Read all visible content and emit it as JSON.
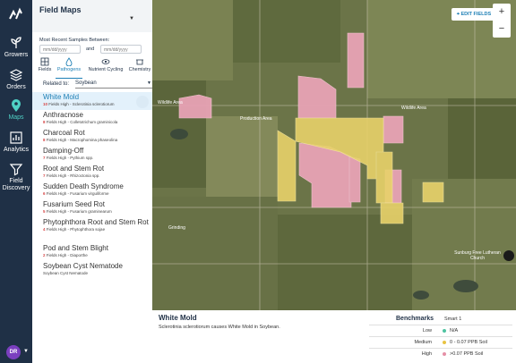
{
  "nav": {
    "items": [
      {
        "label": "Growers",
        "icon": "growers-icon"
      },
      {
        "label": "Orders",
        "icon": "orders-icon"
      },
      {
        "label": "Maps",
        "icon": "map-pin-icon"
      },
      {
        "label": "Analytics",
        "icon": "analytics-icon"
      },
      {
        "label": "Field Discovery",
        "icon": "filter-icon"
      }
    ],
    "avatar": "DR"
  },
  "panel": {
    "title": "Field Maps",
    "samples_label": "Most Recent Samples Between:",
    "date_from_placeholder": "mm/dd/yyyy",
    "date_and": "and",
    "date_to_placeholder": "mm/dd/yyyy",
    "tabs": [
      "Fields",
      "Pathogens",
      "Nutrient Cycling",
      "Chemistry"
    ],
    "related_label": "Related to:",
    "related_value": "Soybean",
    "pathogens": [
      {
        "name": "White Mold",
        "count": "10",
        "sub": "Fields High - Sclerotinia sclerotiorum"
      },
      {
        "name": "Anthracnose",
        "count": "8",
        "sub": "Fields High - Colletotrichum graminicola"
      },
      {
        "name": "Charcoal Rot",
        "count": "8",
        "sub": "Fields High - Macrophomina phaseolina"
      },
      {
        "name": "Damping-Off",
        "count": "7",
        "sub": "Fields High - Pythium spp."
      },
      {
        "name": "Root and Stem Rot",
        "count": "7",
        "sub": "Fields High - Rhizoctonia spp."
      },
      {
        "name": "Sudden Death Syndrome",
        "count": "6",
        "sub": "Fields High - Fusarium virguliforme"
      },
      {
        "name": "Fusarium Seed Rot",
        "count": "5",
        "sub": "Fields High - Fusarium graminearum"
      },
      {
        "name": "Phytophthora Root and Stem Rot",
        "count": "4",
        "sub": "Fields High - Phytophthora sojae"
      },
      {
        "name": "Pod and Stem Blight",
        "count": "2",
        "sub": "Fields High - Diaporthe"
      },
      {
        "name": "Soybean Cyst Nematode",
        "count": "",
        "sub": "Soybean Cyst Nematode"
      }
    ]
  },
  "map": {
    "edit_button": "EDIT FIELDS",
    "zoom_in": "+",
    "zoom_out": "−",
    "labels": {
      "wildlife1": "Wildlife Area",
      "wildlife2": "Wildlife Area",
      "production": "Production Area",
      "church": "Sunburg Free Lutheran Church",
      "grinding": "Grinding"
    }
  },
  "info": {
    "title": "White Mold",
    "description": "Sclerotinia sclerotiorum causes White Mold in Soybean.",
    "benchmarks_label": "Benchmarks",
    "benchmark_source": "Smart 1",
    "rows": [
      {
        "level": "Low",
        "value": "N/A",
        "color": "#4fc3a1"
      },
      {
        "level": "Medium",
        "value": "0 - 0.07 PPB Soil",
        "color": "#e8c341"
      },
      {
        "level": "High",
        "value": ">0.07 PPB Soil",
        "color": "#e58fa6"
      }
    ]
  },
  "colors": {
    "nav_bg": "#1f3046",
    "accent": "#1d7fb5",
    "field_high": "#e8a3b5",
    "field_medium": "#e8d26a"
  }
}
